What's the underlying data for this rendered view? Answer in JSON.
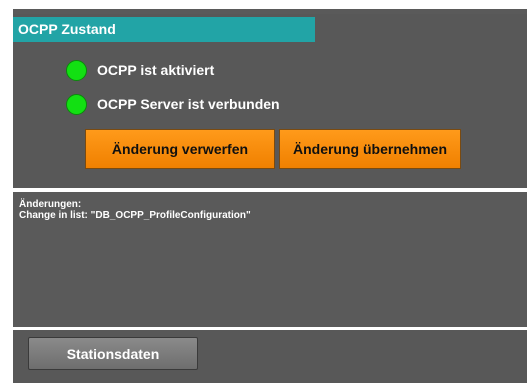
{
  "section": {
    "title": "OCPP Zustand"
  },
  "status": [
    {
      "label": "OCPP ist aktiviert",
      "state": "green"
    },
    {
      "label": "OCPP Server ist verbunden",
      "state": "green"
    }
  ],
  "buttons": {
    "discard": "Änderung verwerfen",
    "apply": "Änderung übernehmen",
    "station": "Stationsdaten"
  },
  "changes": {
    "heading": "Änderungen:",
    "line": "Change in list: \"DB_OCPP_ProfileConfiguration\""
  },
  "colors": {
    "header": "#22a4a6",
    "panel": "#585858",
    "led_on": "#12e012",
    "button_orange": "#f08000"
  }
}
